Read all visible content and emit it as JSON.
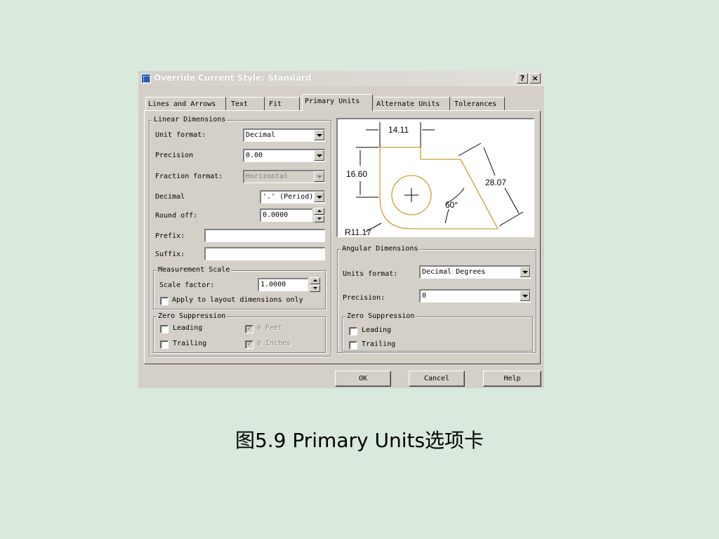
{
  "window": {
    "title": "Override Current Style: Standard",
    "help_btn": "?",
    "close_btn": "×"
  },
  "tabs": [
    {
      "label": "Lines and Arrows"
    },
    {
      "label": "Text"
    },
    {
      "label": "Fit"
    },
    {
      "label": "Primary Units",
      "active": true
    },
    {
      "label": "Alternate Units"
    },
    {
      "label": "Tolerances"
    }
  ],
  "linear": {
    "group_title": "Linear Dimensions",
    "unit_format_label": "Unit format:",
    "unit_format_value": "Decimal",
    "precision_label": "Precision",
    "precision_value": "0.00",
    "fraction_format_label": "Fraction format:",
    "fraction_format_value": "Horizontal",
    "decimal_label": "Decimal",
    "decimal_value": "'.' (Period)",
    "round_off_label": "Round off:",
    "round_off_value": "0.0000",
    "prefix_label": "Prefix:",
    "prefix_value": "",
    "suffix_label": "Suffix:",
    "suffix_value": ""
  },
  "measurement_scale": {
    "group_title": "Measurement Scale",
    "scale_factor_label": "Scale factor:",
    "scale_factor_value": "1.0000",
    "apply_layout_label": "Apply to layout dimensions only"
  },
  "zero_suppression_linear": {
    "group_title": "Zero Suppression",
    "leading_label": "Leading",
    "trailing_label": "Trailing",
    "feet_label": "0 Feet",
    "inches_label": "0 Inches"
  },
  "preview": {
    "dim_top": "14.11",
    "dim_left": "16.60",
    "dim_right": "28.07",
    "angle": "60°",
    "radius": "R11.17"
  },
  "angular": {
    "group_title": "Angular Dimensions",
    "units_format_label": "Units format:",
    "units_format_value": "Decimal Degrees",
    "precision_label": "Precision:",
    "precision_value": "0"
  },
  "zero_suppression_angular": {
    "group_title": "Zero Suppression",
    "leading_label": "Leading",
    "trailing_label": "Trailing"
  },
  "buttons": {
    "ok": "OK",
    "cancel": "Cancel",
    "help": "Help"
  },
  "caption": "图5.9  Primary Units选项卡",
  "colors": {
    "background": "#d9e9dc",
    "dialog": "#d4d0c8",
    "preview_shape": "#c8a030"
  }
}
